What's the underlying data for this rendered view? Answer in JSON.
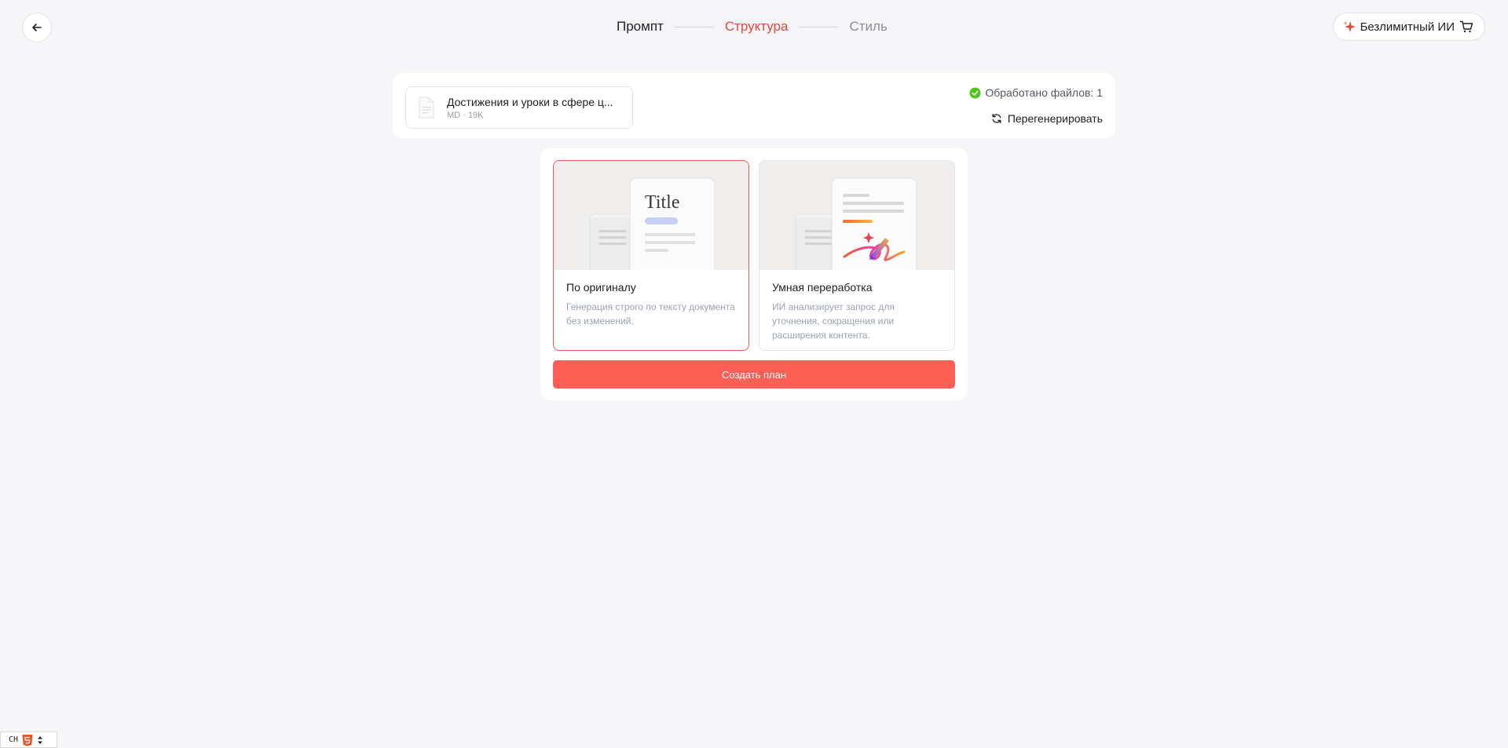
{
  "stepper": {
    "steps": [
      "Промпт",
      "Структура",
      "Стиль"
    ]
  },
  "upgrade": {
    "label": "Безлимитный ИИ"
  },
  "files": {
    "file_name": "Достижения и уроки в сфере ц...",
    "file_meta": "MD · 19K",
    "processed": "Обработано файлов: 1",
    "regenerate": "Перегенерировать"
  },
  "options": {
    "original": {
      "preview_title": "Title",
      "title": "По оригиналу",
      "desc": "Генерация строго по тексту документа без изменений."
    },
    "smart": {
      "title": "Умная переработка",
      "desc": "ИИ анализирует запрос для уточнения, сокращения или расширения контента."
    }
  },
  "create_button": "Создать план",
  "ime": {
    "label": "CH"
  },
  "colors": {
    "accent": "#e4473d",
    "button": "#fe5f55",
    "success": "#52c41a"
  }
}
